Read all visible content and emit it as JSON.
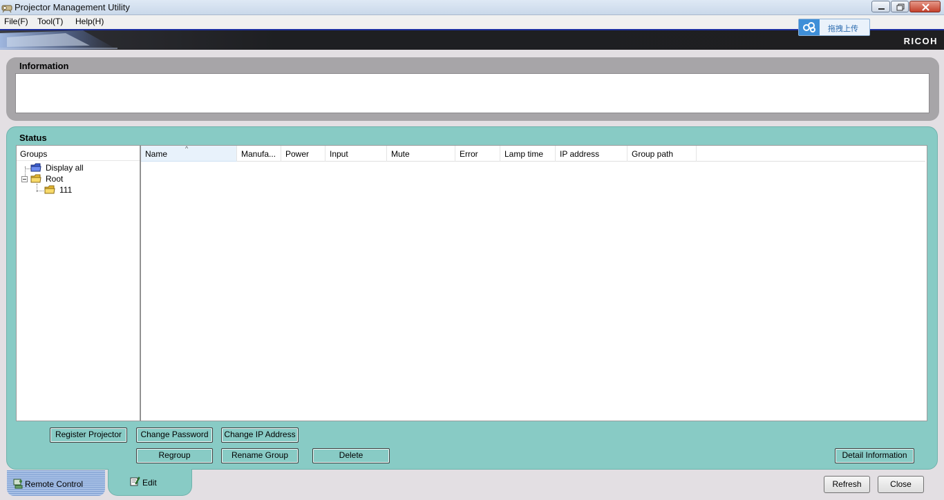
{
  "window": {
    "title": "Projector Management Utility"
  },
  "menu": {
    "items": [
      "File(F)",
      "Tool(T)",
      "Help(H)"
    ]
  },
  "header": {
    "brand": "RICOH",
    "upload_label": "拖拽上传"
  },
  "information": {
    "title": "Information"
  },
  "status": {
    "title": "Status",
    "groups_header": "Groups",
    "tree": [
      {
        "label": "Display all",
        "icon": "blue-folder-icon"
      },
      {
        "label": "Root",
        "icon": "folder-icon",
        "expanded": true
      },
      {
        "label": "111",
        "icon": "folder-icon"
      }
    ],
    "columns": [
      "Name",
      "Manufa...",
      "Power",
      "Input",
      "Mute",
      "Error",
      "Lamp time",
      "IP address",
      "Group path"
    ],
    "sorted_column": "Name"
  },
  "buttons": {
    "register_projector": "Register Projector",
    "change_password": "Change Password",
    "change_ip": "Change IP Address",
    "regroup": "Regroup",
    "rename_group": "Rename Group",
    "delete": "Delete",
    "detail_information": "Detail Information",
    "refresh": "Refresh",
    "close": "Close"
  },
  "tabs": {
    "remote_control": "Remote Control",
    "edit": "Edit"
  },
  "colors": {
    "status_panel": "#88cbc5",
    "info_panel": "#a7a5a8",
    "header_band": "#1f1f21"
  }
}
